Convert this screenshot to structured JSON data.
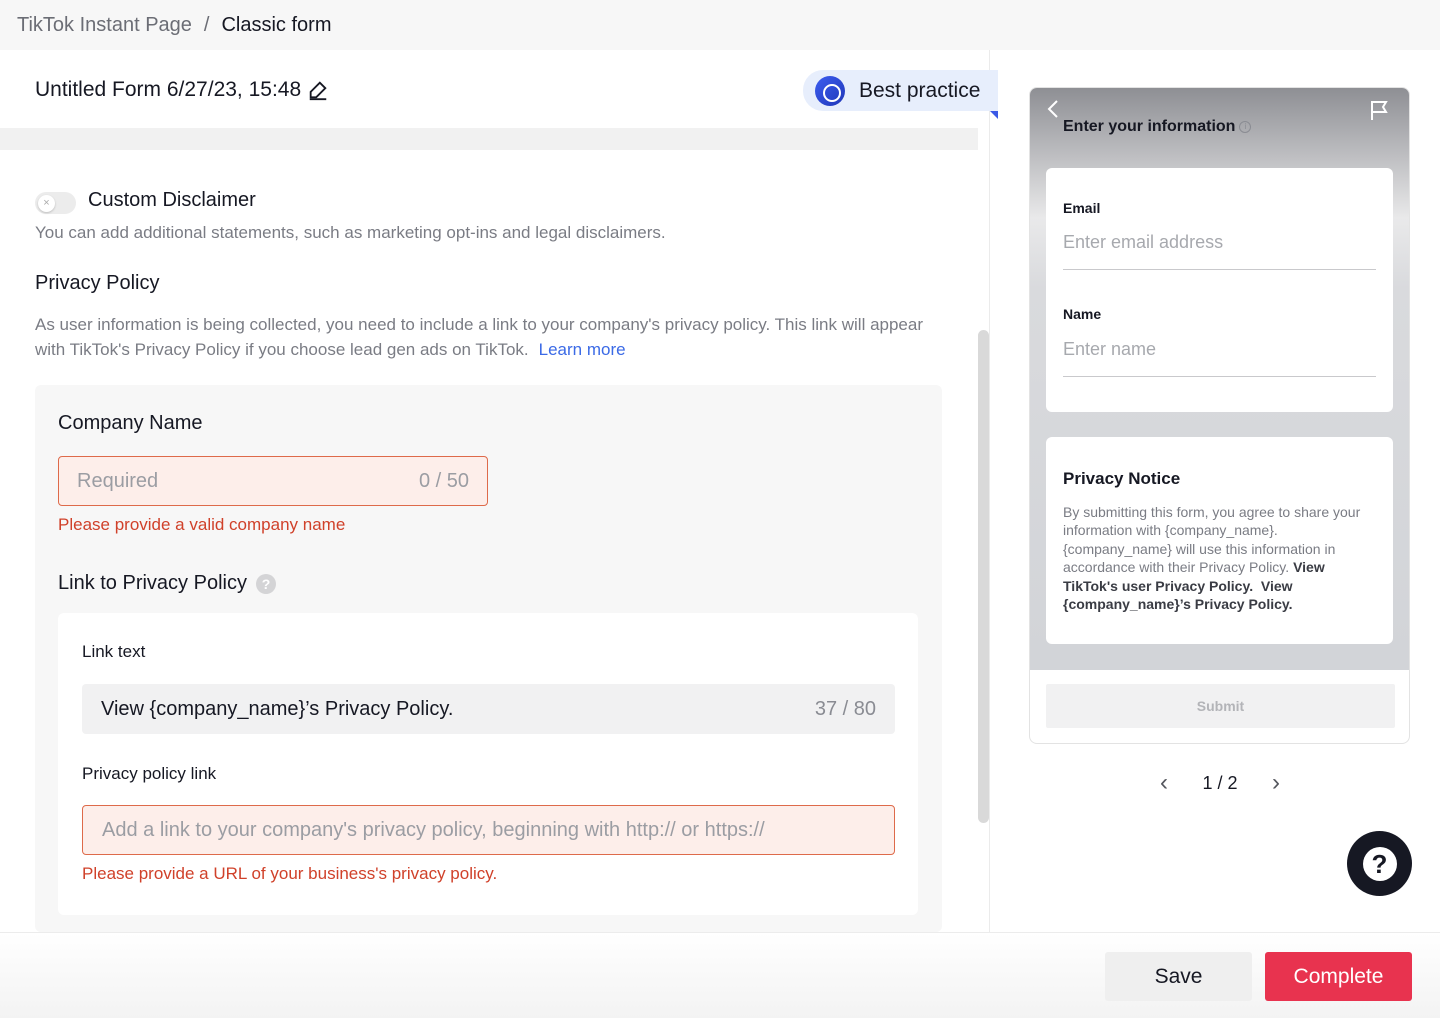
{
  "breadcrumb": {
    "root": "TikTok Instant Page",
    "separator": "/",
    "current": "Classic form"
  },
  "form_title": "Untitled Form 6/27/23, 15:48",
  "best_practice_label": "Best practice",
  "custom_disclaimer": {
    "label": "Custom Disclaimer",
    "enabled": false,
    "description": "You can add additional statements, such as marketing opt-ins and legal disclaimers."
  },
  "privacy_policy": {
    "heading": "Privacy Policy",
    "description": "As user information is being collected, you need to include a link to your company's privacy policy. This link will appear with TikTok's Privacy Policy if you choose lead gen ads on TikTok.",
    "learn_more": "Learn more"
  },
  "company_name": {
    "label": "Company Name",
    "placeholder": "Required",
    "counter": "0 / 50",
    "error": "Please provide a valid company name"
  },
  "link_to_privacy_policy": {
    "label": "Link to Privacy Policy",
    "help": "?",
    "link_text_label": "Link text",
    "link_text_value": "View {company_name}’s Privacy Policy.",
    "link_text_counter": "37 / 80",
    "policy_link_label": "Privacy policy link",
    "policy_link_placeholder": "Add a link to your company's privacy policy, beginning with http:// or https://",
    "policy_link_error": "Please provide a URL of your business's privacy policy."
  },
  "preview": {
    "back_icon": "chevron-left-icon",
    "flag_icon": "flag-icon",
    "title": "Enter your information",
    "info_icon": "i",
    "email_label": "Email",
    "email_placeholder": "Enter email address",
    "name_label": "Name",
    "name_placeholder": "Enter name",
    "notice_title": "Privacy Notice",
    "notice_text": "By submitting this form, you agree to share your information with {company_name}. {company_name} will use this information in accordance with their Privacy Policy.",
    "notice_link1": "View TikTok's user Privacy Policy.",
    "notice_link2": "View {company_name}’s Privacy Policy.",
    "submit": "Submit"
  },
  "pager": {
    "prev": "‹",
    "label": "1 / 2",
    "next": "›"
  },
  "help_fab": "?",
  "footer": {
    "save": "Save",
    "complete": "Complete"
  },
  "colors": {
    "accent": "#e8334f",
    "error": "#d0412a",
    "link": "#3b6ae6",
    "best_practice_bg": "#e7eefc"
  }
}
